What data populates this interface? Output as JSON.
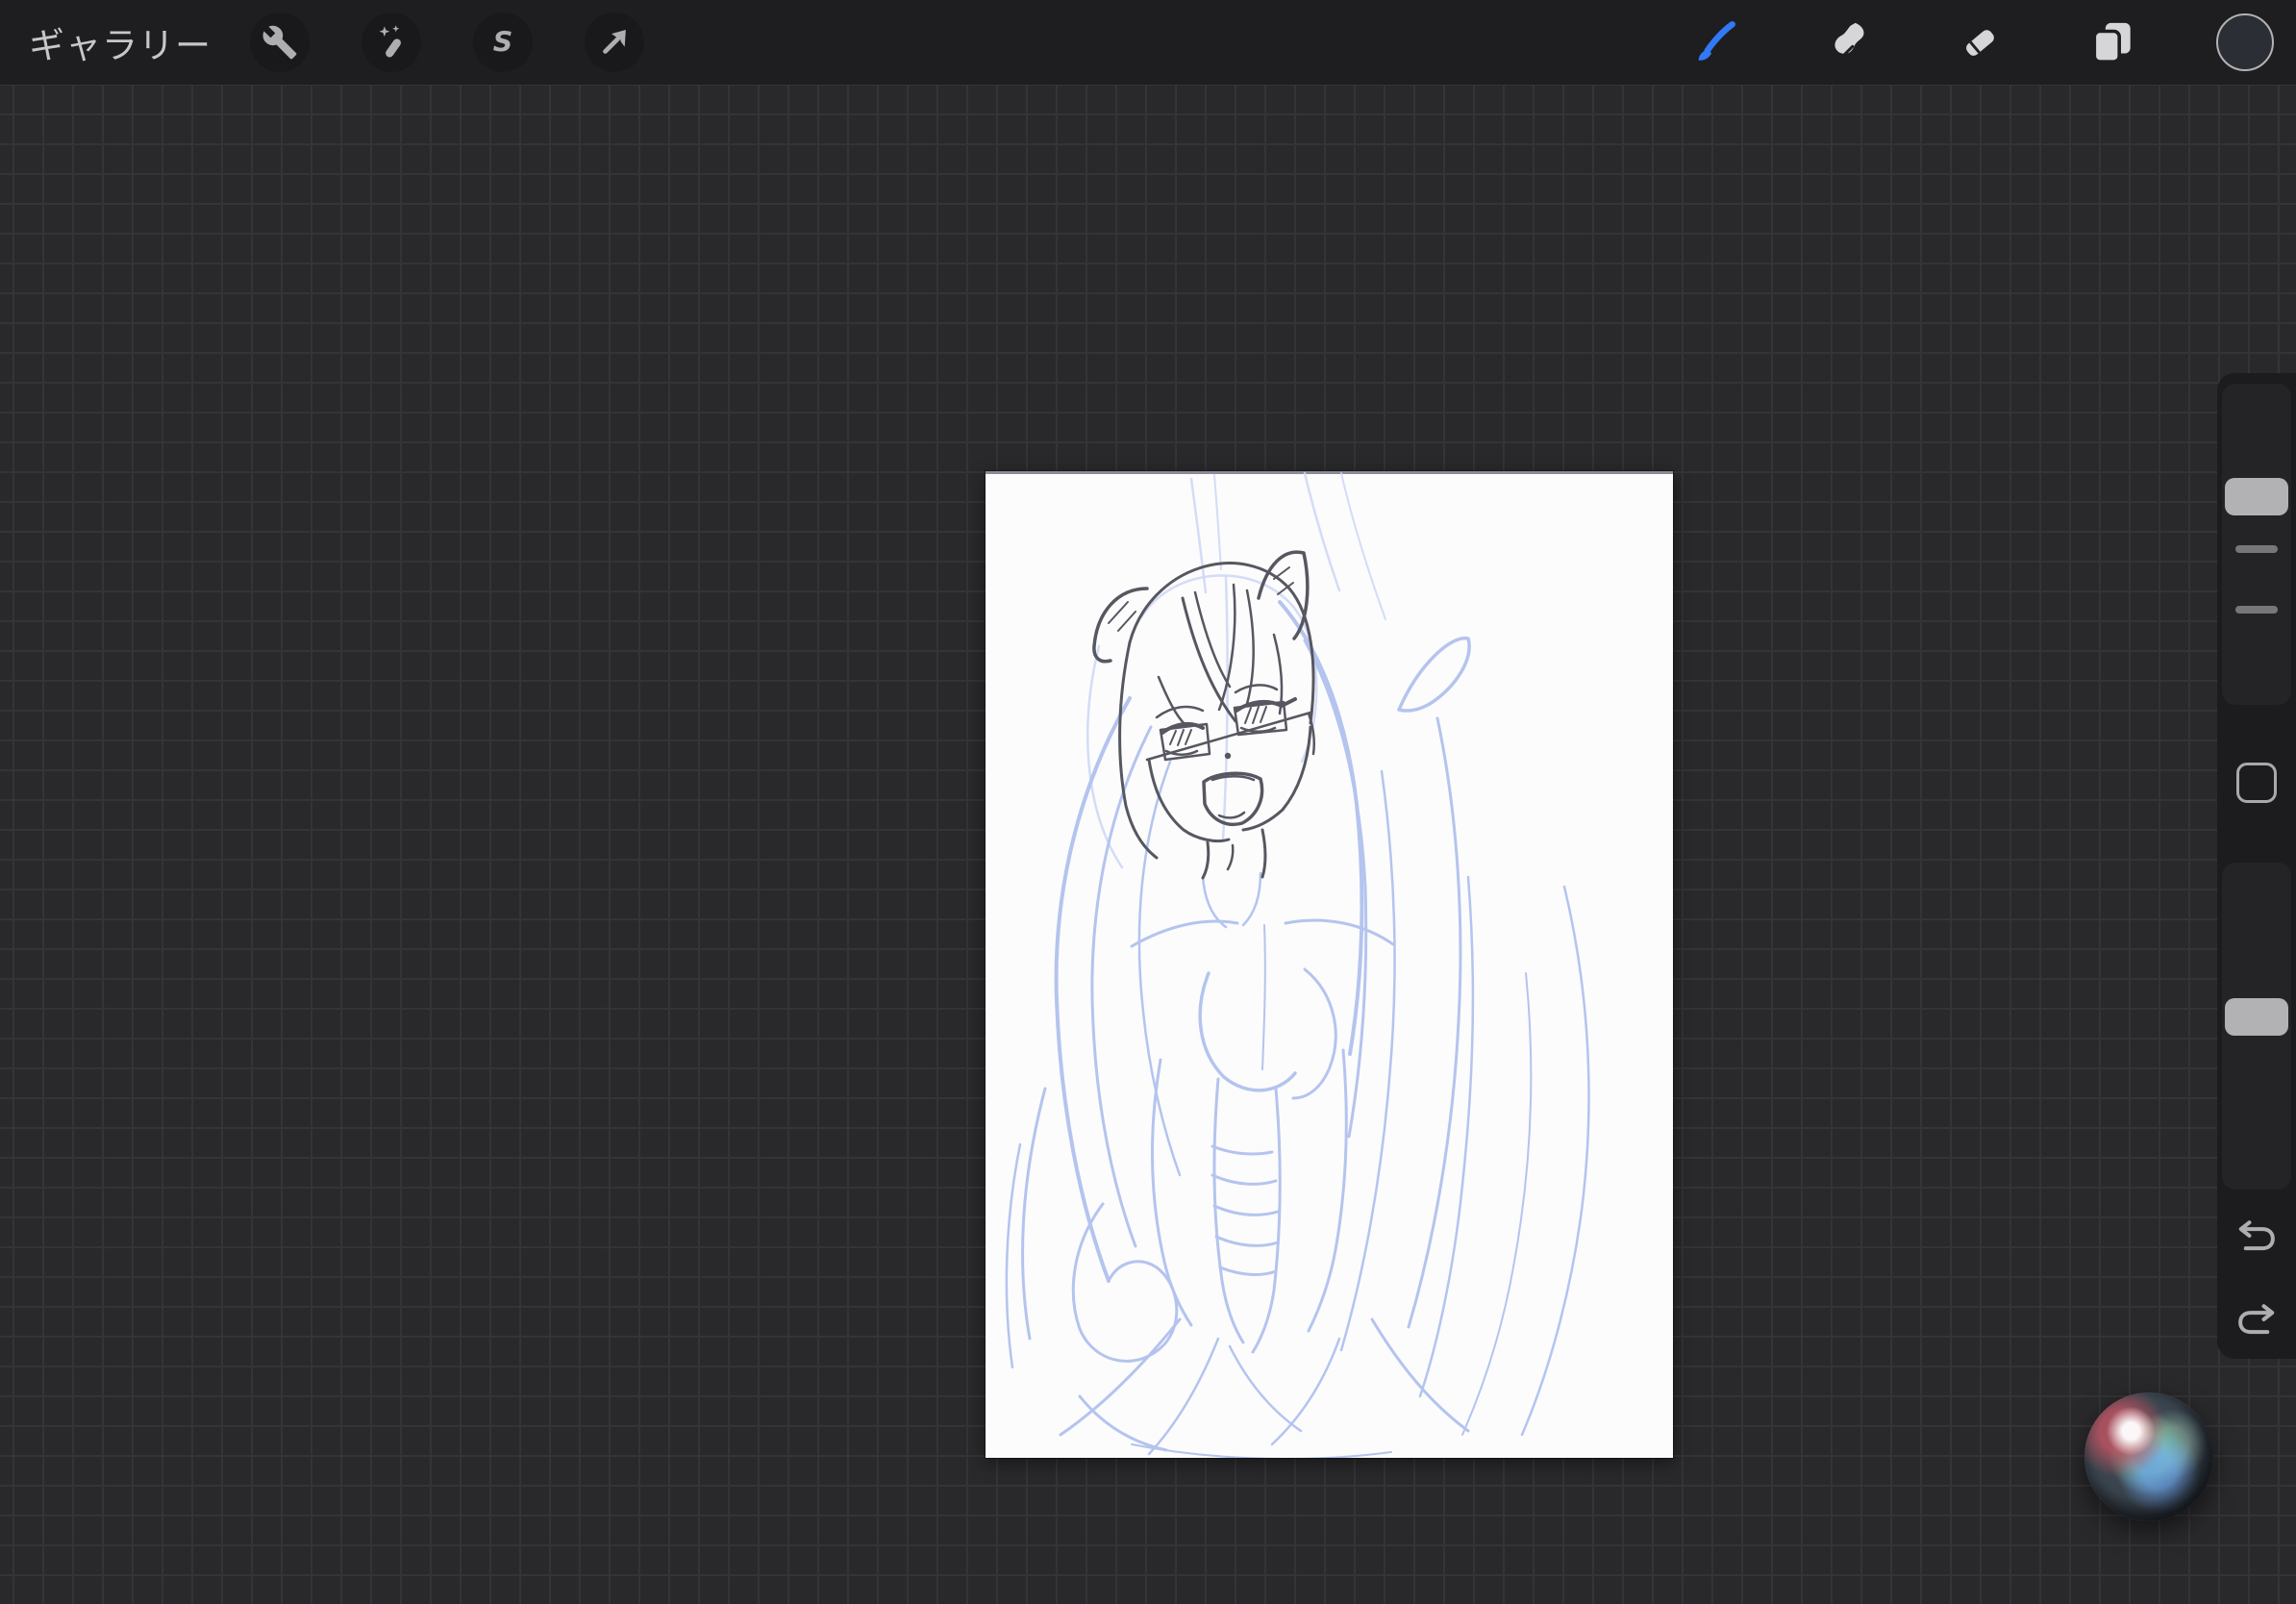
{
  "topbar": {
    "gallery_label": "ギャラリー",
    "left_tools": [
      {
        "id": "actions",
        "icon": "wrench-icon"
      },
      {
        "id": "adjustments",
        "icon": "magic-wand-icon",
        "glyph": ""
      },
      {
        "id": "selection",
        "icon": "selection-s-icon",
        "glyph": "S"
      },
      {
        "id": "transform",
        "icon": "move-arrow-icon"
      }
    ],
    "right_tools": [
      {
        "id": "paint",
        "icon": "paintbrush-icon",
        "active": true
      },
      {
        "id": "smudge",
        "icon": "smudge-icon",
        "active": false
      },
      {
        "id": "erase",
        "icon": "eraser-icon",
        "active": false
      },
      {
        "id": "layers",
        "icon": "layers-icon",
        "active": false
      }
    ],
    "color_swatch": {
      "fill": "#2b2e35",
      "ring": "#b2b2b5"
    }
  },
  "sidebar": {
    "size_slider": {
      "handle_top": "29.3%",
      "memory_ticks_top": [
        "50.3%",
        "69.2%"
      ]
    },
    "opacity_slider": {
      "handle_top": "41.5%"
    },
    "modify_button": "modify-square",
    "undo_icon": "undo-arrow-icon",
    "redo_icon": "redo-arrow-icon"
  },
  "artwork": {
    "type": "rough-sketch",
    "subject": "anime girl with cat-ear hair tufts, glasses and open smile",
    "construction_line_color": "#b4c4ee",
    "pencil_line_color": "#575761",
    "canvas_color": "#fcfcfd"
  },
  "colors": {
    "bg": "#29292b",
    "grid": "#343437",
    "topbar": "#1e1e20",
    "circle": "#19191b",
    "icon": "#aeaeb1",
    "icon-bright": "#d6d6d8",
    "text": "#c7c7c9",
    "accent": "#3179f6",
    "panel": "#1c1c1e",
    "track": "#242427",
    "handle": "#b2b2b5",
    "tick": "#77777a",
    "outline": "#a9a9ac",
    "canvas": "#fcfcfd",
    "swatch": "#2b2e35",
    "sketch-blue": "#b4c4ee",
    "sketch-blue-light": "#ccd6f4",
    "sketch-dark": "#575761"
  }
}
